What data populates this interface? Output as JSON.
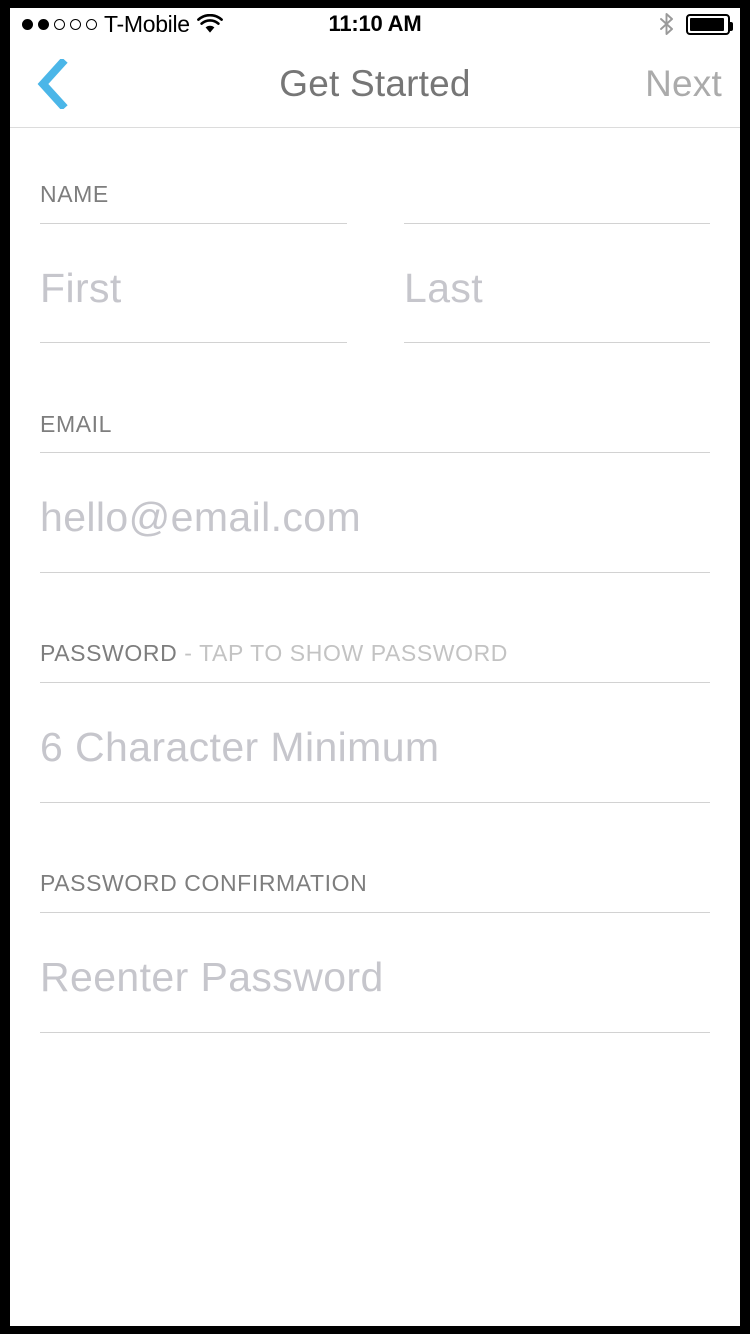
{
  "status_bar": {
    "signal_dots_total": 5,
    "signal_dots_filled": 2,
    "carrier": "T-Mobile",
    "wifi_icon": "wifi-icon",
    "time": "11:10 AM",
    "bluetooth_icon": "bluetooth-icon",
    "battery_icon": "battery-icon",
    "battery_percent": 85
  },
  "nav_bar": {
    "back_icon": "chevron-left-icon",
    "back_color": "#4bb6e8",
    "title": "Get Started",
    "title_color": "#767676",
    "next_label": "Next",
    "next_color": "#ababab"
  },
  "form": {
    "sections": [
      {
        "id": "name",
        "label": "NAME",
        "hint": "",
        "layout": "split",
        "fields": [
          {
            "id": "first-name",
            "placeholder": "First",
            "value": ""
          },
          {
            "id": "last-name",
            "placeholder": "Last",
            "value": ""
          }
        ]
      },
      {
        "id": "email",
        "label": "EMAIL",
        "hint": "",
        "layout": "full",
        "fields": [
          {
            "id": "email",
            "placeholder": "hello@email.com",
            "value": ""
          }
        ]
      },
      {
        "id": "password",
        "label": "PASSWORD",
        "hint": " - TAP TO SHOW PASSWORD",
        "layout": "full",
        "fields": [
          {
            "id": "password",
            "placeholder": "6 Character Minimum",
            "value": ""
          }
        ]
      },
      {
        "id": "password-confirmation",
        "label": "PASSWORD CONFIRMATION",
        "hint": "",
        "layout": "full",
        "fields": [
          {
            "id": "password-confirmation",
            "placeholder": "Reenter Password",
            "value": ""
          }
        ]
      }
    ]
  },
  "colors": {
    "accent": "#4bb6e8",
    "label_text": "#7e7e7e",
    "hint_text": "#c3c3c3",
    "placeholder_text": "#c6c6cc",
    "rule": "#d2d2d2",
    "background": "#ffffff"
  }
}
